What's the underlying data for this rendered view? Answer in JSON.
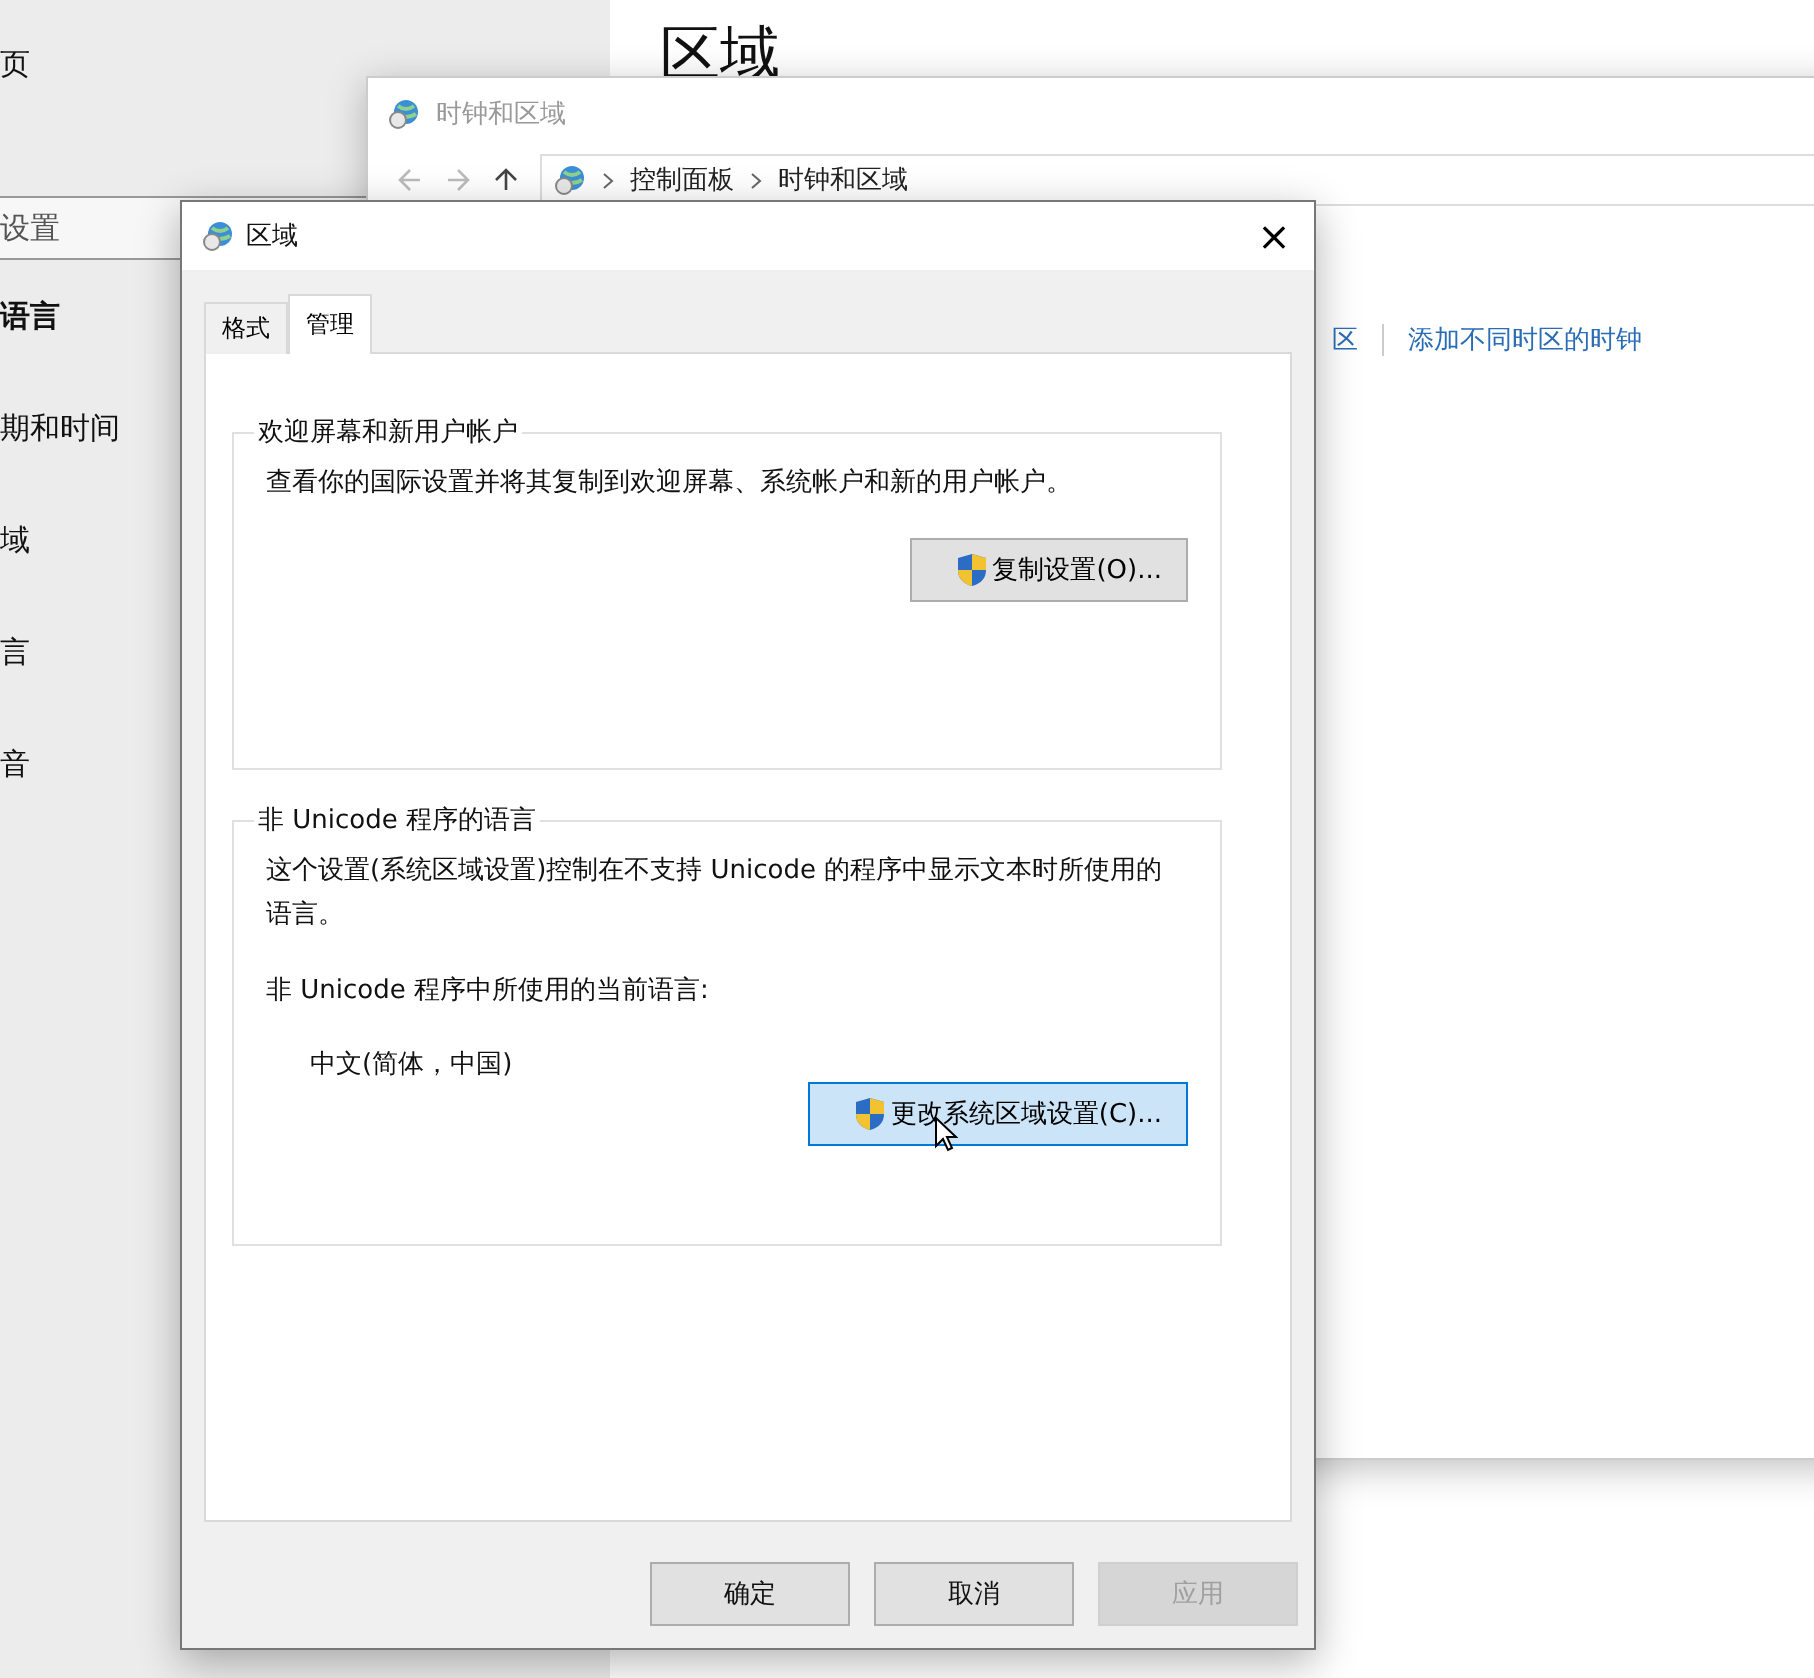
{
  "settings": {
    "home": "页",
    "search": {
      "value": "设置"
    },
    "section": "语言",
    "nav_items": [
      {
        "label": "期和时间"
      },
      {
        "label": "域"
      },
      {
        "label": "言"
      },
      {
        "label": "音"
      }
    ],
    "page_title": "区域"
  },
  "clock_window": {
    "title": "时钟和区域",
    "breadcrumb": [
      "控制面板",
      "时钟和区域"
    ],
    "links": [
      "区",
      "添加不同时区的时钟"
    ]
  },
  "dialog": {
    "title": "区域",
    "close": "×",
    "tabs": [
      {
        "label": "格式",
        "selected": false
      },
      {
        "label": "管理",
        "selected": true
      }
    ],
    "groups": [
      {
        "legend": "欢迎屏幕和新用户帐户",
        "items": [
          {
            "kind": "text",
            "text": "查看你的国际设置并将其复制到欢迎屏幕、系统帐户和新的用户帐户。"
          },
          {
            "kind": "button",
            "text": "复制设置(O)...",
            "highlighted": false
          }
        ]
      },
      {
        "legend": "非 Unicode 程序的语言",
        "items": [
          {
            "kind": "text",
            "text": "这个设置(系统区域设置)控制在不支持 Unicode 的程序中显示文本时所使用的语言。"
          },
          {
            "kind": "text",
            "text": "非 Unicode 程序中所使用的当前语言:"
          },
          {
            "kind": "value",
            "text": "中文(简体，中国)"
          },
          {
            "kind": "button",
            "text": "更改系统区域设置(C)...",
            "highlighted": true
          }
        ]
      }
    ],
    "buttons": [
      {
        "label": "确定",
        "disabled": false
      },
      {
        "label": "取消",
        "disabled": false
      },
      {
        "label": "应用",
        "disabled": true
      }
    ]
  }
}
